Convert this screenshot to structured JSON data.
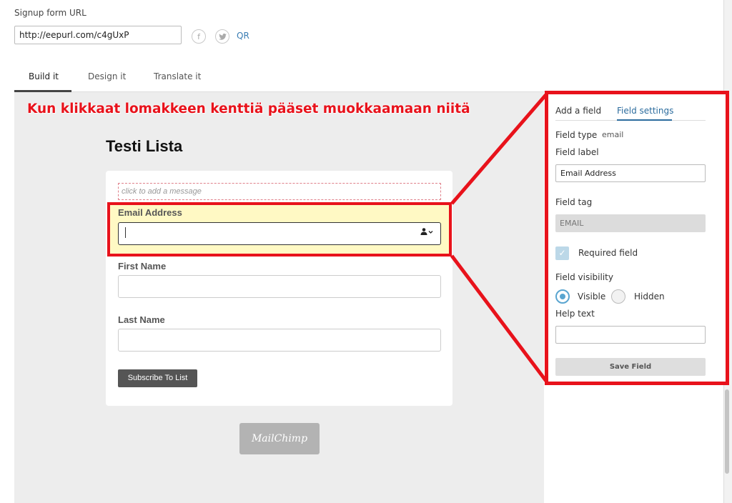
{
  "signup": {
    "label": "Signup form URL",
    "url": "http://eepurl.com/c4gUxP",
    "qr": "QR",
    "facebook_icon": "facebook-icon",
    "twitter_icon": "twitter-icon"
  },
  "tabs": [
    "Build it",
    "Design it",
    "Translate it"
  ],
  "annotation": "Kun klikkaat lomakkeen kenttiä pääset muokkaamaan niitä",
  "form": {
    "title": "Testi Lista",
    "message_placeholder": "click to add a message",
    "fields": [
      {
        "label": "Email Address",
        "value": ""
      },
      {
        "label": "First Name",
        "value": ""
      },
      {
        "label": "Last Name",
        "value": ""
      }
    ],
    "subscribe_label": "Subscribe To List",
    "merge_icon": "person-icon",
    "badge": "MailChimp"
  },
  "settings": {
    "tabs": [
      "Add a field",
      "Field settings"
    ],
    "field_type_label": "Field type",
    "field_type_value": "email",
    "field_label_label": "Field label",
    "field_label_value": "Email Address",
    "field_tag_label": "Field tag",
    "field_tag_value": "EMAIL",
    "required_label": "Required field",
    "required_checked": true,
    "visibility_label": "Field visibility",
    "visible_label": "Visible",
    "hidden_label": "Hidden",
    "visibility_selected": "Visible",
    "help_text_label": "Help text",
    "help_text_value": "",
    "save_label": "Save Field"
  },
  "colors": {
    "annotation_red": "#e8121b",
    "link_blue": "#2c6c9e",
    "highlight_yellow": "#fff9c4",
    "canvas_gray": "#ededed"
  }
}
